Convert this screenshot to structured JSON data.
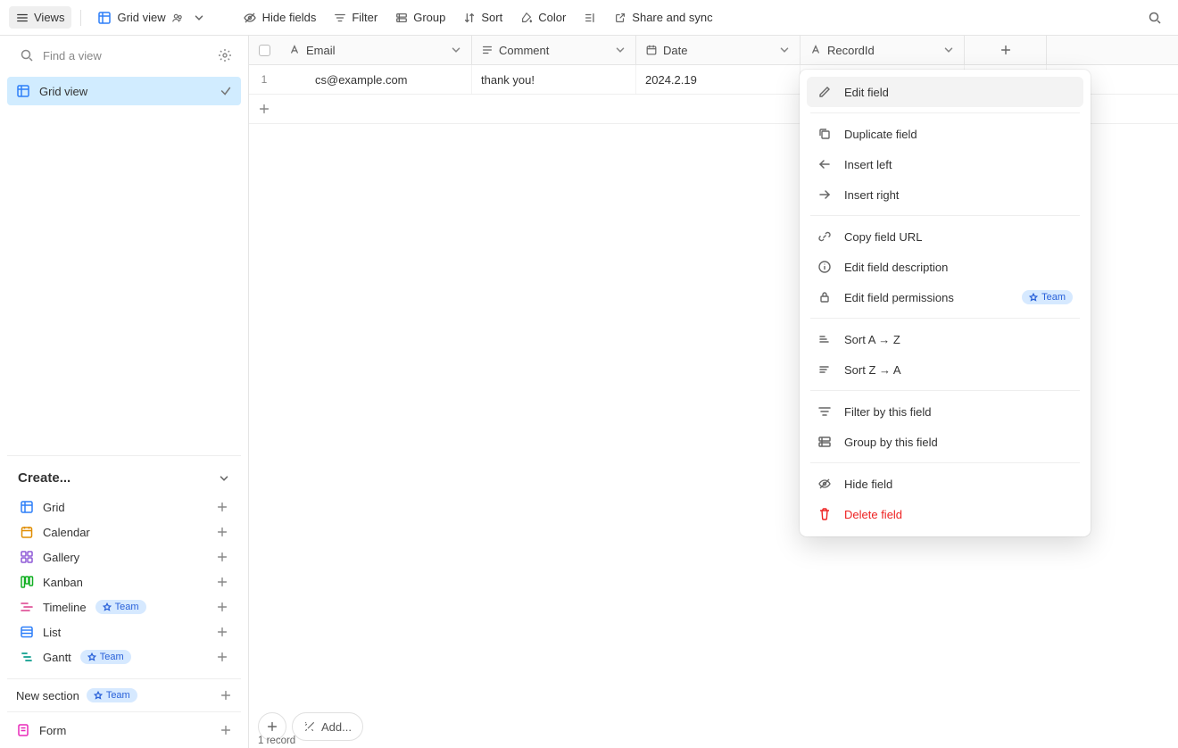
{
  "toolbar": {
    "views_label": "Views",
    "current_view": "Grid view",
    "hide_fields": "Hide fields",
    "filter": "Filter",
    "group": "Group",
    "sort": "Sort",
    "color": "Color",
    "share": "Share and sync"
  },
  "sidebar": {
    "search_placeholder": "Find a view",
    "views": [
      {
        "label": "Grid view"
      }
    ],
    "create_heading": "Create...",
    "create_items": [
      {
        "label": "Grid",
        "icon": "grid",
        "color": "blue",
        "badge": null
      },
      {
        "label": "Calendar",
        "icon": "calendar",
        "color": "orange",
        "badge": null
      },
      {
        "label": "Gallery",
        "icon": "gallery",
        "color": "purple",
        "badge": null
      },
      {
        "label": "Kanban",
        "icon": "kanban",
        "color": "green",
        "badge": null
      },
      {
        "label": "Timeline",
        "icon": "timeline",
        "color": "rose",
        "badge": "Team"
      },
      {
        "label": "List",
        "icon": "list",
        "color": "blue",
        "badge": null
      },
      {
        "label": "Gantt",
        "icon": "gantt",
        "color": "teal",
        "badge": "Team"
      }
    ],
    "new_section": "New section",
    "new_section_badge": "Team",
    "form_label": "Form"
  },
  "grid": {
    "columns": [
      {
        "label": "Email",
        "type": "text"
      },
      {
        "label": "Comment",
        "type": "longtext"
      },
      {
        "label": "Date",
        "type": "date"
      },
      {
        "label": "RecordId",
        "type": "text"
      }
    ],
    "rows": [
      {
        "num": "1",
        "email": "cs@example.com",
        "comment": "thank you!",
        "date": "2024.2.19",
        "recordid": ""
      }
    ],
    "add_label": "Add...",
    "record_count": "1 record"
  },
  "context_menu": {
    "items": [
      {
        "label": "Edit field",
        "icon": "pencil",
        "hover": true
      },
      {
        "sep": true
      },
      {
        "label": "Duplicate field",
        "icon": "duplicate"
      },
      {
        "label": "Insert left",
        "icon": "arrow-left"
      },
      {
        "label": "Insert right",
        "icon": "arrow-right"
      },
      {
        "sep": true
      },
      {
        "label": "Copy field URL",
        "icon": "link"
      },
      {
        "label": "Edit field description",
        "icon": "info"
      },
      {
        "label": "Edit field permissions",
        "icon": "lock",
        "badge": "Team"
      },
      {
        "sep": true
      },
      {
        "label": "Sort A → Z",
        "icon": "sort-asc"
      },
      {
        "label": "Sort Z → A",
        "icon": "sort-desc"
      },
      {
        "sep": true
      },
      {
        "label": "Filter by this field",
        "icon": "filter"
      },
      {
        "label": "Group by this field",
        "icon": "group"
      },
      {
        "sep": true
      },
      {
        "label": "Hide field",
        "icon": "eye-off"
      },
      {
        "label": "Delete field",
        "icon": "trash",
        "danger": true
      }
    ]
  }
}
